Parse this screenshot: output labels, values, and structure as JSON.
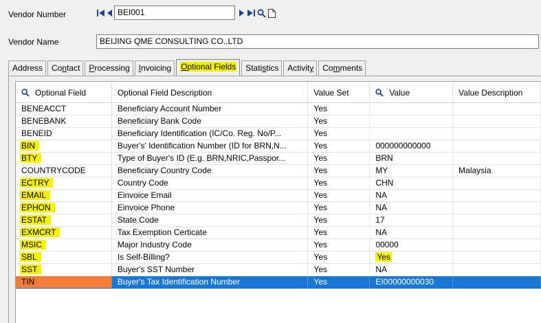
{
  "header": {
    "vendor_number_label": "Vendor Number",
    "vendor_number_value": "BEI001",
    "vendor_name_label": "Vendor Name",
    "vendor_name_value": "BEIJING QME CONSULTING CO.,LTD"
  },
  "tabs": [
    {
      "pre": "Address",
      "u": "",
      "post": ""
    },
    {
      "pre": "Co",
      "u": "n",
      "post": "tact"
    },
    {
      "pre": "",
      "u": "P",
      "post": "rocessing"
    },
    {
      "pre": "",
      "u": "I",
      "post": "nvoicing"
    },
    {
      "pre": "",
      "u": "O",
      "post": "ptional Fields"
    },
    {
      "pre": "Stati",
      "u": "s",
      "post": "tics"
    },
    {
      "pre": "Activit",
      "u": "y",
      "post": ""
    },
    {
      "pre": "Co",
      "u": "m",
      "post": "ments"
    }
  ],
  "columns": [
    "Optional Field",
    "Optional Field Description",
    "Value Set",
    "Value",
    "Value Description"
  ],
  "rows": [
    {
      "field": "BENEACCT",
      "desc": "Beneficiary Account Number",
      "set": "Yes",
      "value": "",
      "vdesc": ""
    },
    {
      "field": "BENEBANK",
      "desc": "Beneficiary Bank Code",
      "set": "Yes",
      "value": "",
      "vdesc": ""
    },
    {
      "field": "BENEID",
      "desc": "Beneficiary Identification (IC/Co. Reg. No/P...",
      "set": "Yes",
      "value": "",
      "vdesc": ""
    },
    {
      "field": "BIN",
      "desc": "Buyer's' Identification Number (ID for BRN,N...",
      "set": "Yes",
      "value": "000000000000",
      "vdesc": ""
    },
    {
      "field": "BTY",
      "desc": "Type of Buyer's ID (E.g. BRN,NRIC,Passpor...",
      "set": "Yes",
      "value": "BRN",
      "vdesc": ""
    },
    {
      "field": "COUNTRYCODE",
      "desc": "Beneficiary Country Code",
      "set": "Yes",
      "value": "MY",
      "vdesc": "Malaysia"
    },
    {
      "field": "ECTRY",
      "desc": "Country Code",
      "set": "Yes",
      "value": "CHN",
      "vdesc": ""
    },
    {
      "field": "EMAIL",
      "desc": "Einvoice Email",
      "set": "Yes",
      "value": "NA",
      "vdesc": ""
    },
    {
      "field": "EPHON",
      "desc": "Einvoice Phone",
      "set": "Yes",
      "value": "NA",
      "vdesc": ""
    },
    {
      "field": "ESTAT",
      "desc": "State Code",
      "set": "Yes",
      "value": "17",
      "vdesc": ""
    },
    {
      "field": "EXMCRT",
      "desc": "Tax Exemption Certicate",
      "set": "Yes",
      "value": "NA",
      "vdesc": ""
    },
    {
      "field": "MSIC",
      "desc": "Major Industry Code",
      "set": "Yes",
      "value": "00000",
      "vdesc": ""
    },
    {
      "field": "SBL",
      "desc": "Is Self-Billing?",
      "set": "Yes",
      "value": "Yes",
      "vdesc": ""
    },
    {
      "field": "SST",
      "desc": "Buyer's SST Number",
      "set": "Yes",
      "value": "NA",
      "vdesc": ""
    },
    {
      "field": "TIN",
      "desc": "Buyer's Tax Identification Number",
      "set": "Yes",
      "value": "EI00000000030",
      "vdesc": ""
    }
  ],
  "highlight_fields": [
    "BIN",
    "BTY",
    "ECTRY",
    "EMAIL",
    "EPHON",
    "ESTAT",
    "EXMCRT",
    "MSIC",
    "SBL",
    "SST"
  ],
  "highlight_values": [
    "Yes"
  ],
  "selected_field": "TIN",
  "colors": {
    "highlight": "#f5f200",
    "selection": "#1a77d1",
    "selected_cell": "#f47c36",
    "nav": "#1f3f8f"
  },
  "icons": {
    "first": "first-record-icon",
    "prev": "previous-record-icon",
    "next": "next-record-icon",
    "last": "last-record-icon",
    "finder": "finder-icon",
    "new": "new-record-icon",
    "search": "search-icon"
  }
}
